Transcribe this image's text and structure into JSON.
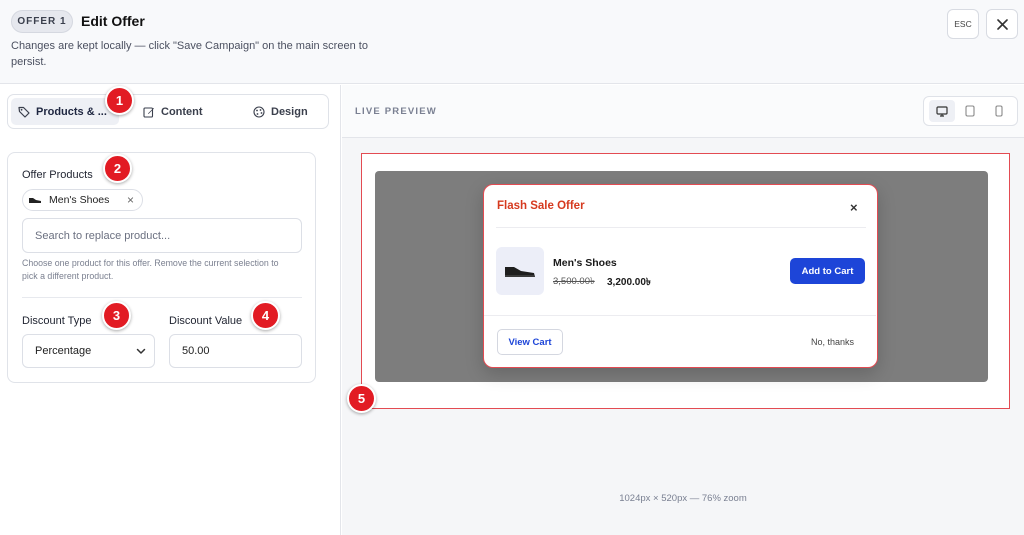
{
  "header": {
    "badge": "OFFER 1",
    "title": "Edit Offer",
    "subtitle": "Changes are kept locally — click \"Save Campaign\" on the main screen to persist.",
    "esc_label": "ESC"
  },
  "tabs": [
    {
      "label": "Products & ...",
      "icon": "tag-icon",
      "active": true
    },
    {
      "label": "Content",
      "icon": "edit-icon",
      "active": false
    },
    {
      "label": "Design",
      "icon": "palette-icon",
      "active": false
    }
  ],
  "form": {
    "offer_products_label": "Offer Products",
    "selected_product": "Men's Shoes",
    "search_placeholder": "Search to replace product...",
    "help_text": "Choose one product for this offer. Remove the current selection to pick a different product.",
    "discount_type_label": "Discount Type",
    "discount_type_value": "Percentage",
    "discount_value_label": "Discount Value",
    "discount_value": "50.00"
  },
  "preview": {
    "label": "LIVE PREVIEW",
    "devices": [
      "desktop-icon",
      "tablet-icon",
      "mobile-icon"
    ],
    "active_device": "desktop-icon",
    "dimensions": "1024px × 520px — 76% zoom"
  },
  "popup": {
    "title": "Flash Sale Offer",
    "product_name": "Men's Shoes",
    "old_price": "3,500.00৳",
    "new_price": "3,200.00৳",
    "cta": "Add to Cart",
    "view_cart": "View Cart",
    "dismiss": "No, thanks"
  },
  "markers": [
    "1",
    "2",
    "3",
    "4",
    "5"
  ],
  "colors": {
    "marker": "#e21b23",
    "cta": "#1d45d8",
    "popup_title": "#d63a1f",
    "highlight_border": "#e34b52"
  }
}
